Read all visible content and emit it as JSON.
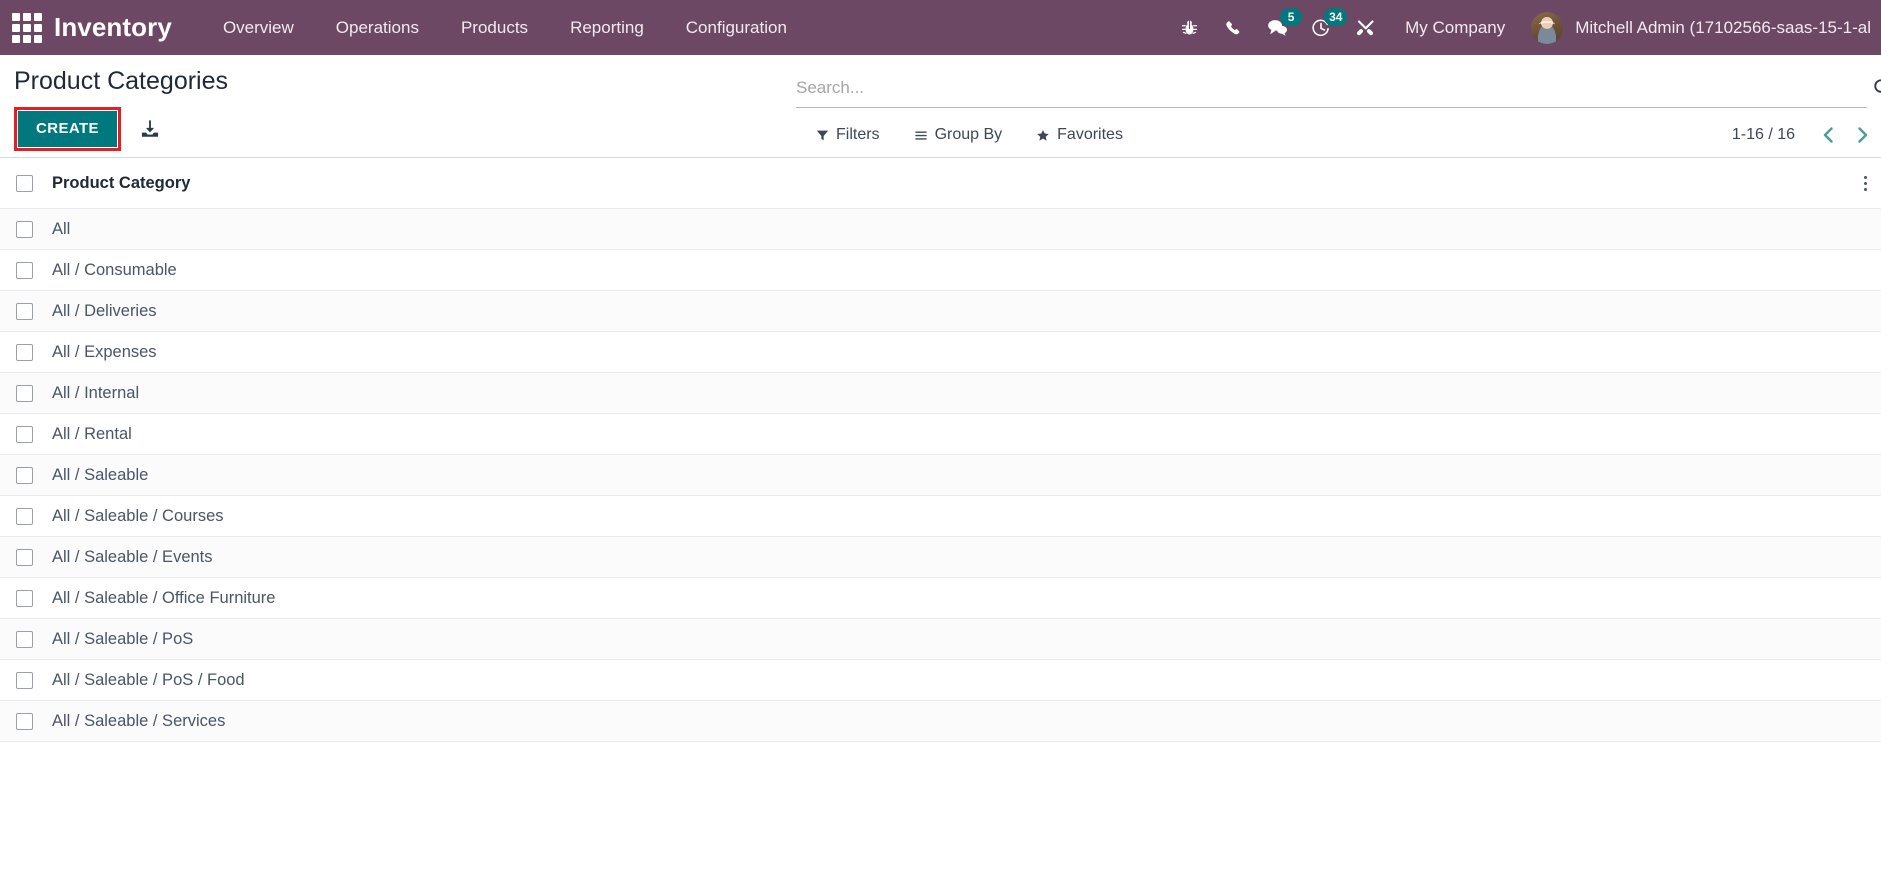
{
  "navbar": {
    "apps_icon": "apps-grid-icon",
    "brand": "Inventory",
    "menu": [
      {
        "label": "Overview"
      },
      {
        "label": "Operations"
      },
      {
        "label": "Products"
      },
      {
        "label": "Reporting"
      },
      {
        "label": "Configuration"
      }
    ],
    "sys_icons": [
      {
        "name": "bug-icon",
        "badge": null
      },
      {
        "name": "phone-icon",
        "badge": null
      },
      {
        "name": "messages-icon",
        "badge": "5"
      },
      {
        "name": "activities-clock-icon",
        "badge": "34"
      },
      {
        "name": "tools-icon",
        "badge": null
      }
    ],
    "company": "My Company",
    "user": "Mitchell Admin (17102566-saas-15-1-al",
    "avatar_icon": "user-avatar",
    "accent_color": "#6d4864",
    "badge_color": "#00787d"
  },
  "control_panel": {
    "title": "Product Categories",
    "create_label": "CREATE",
    "create_color": "#00787d",
    "highlight_color": "#e81c24",
    "export_icon": "download-export-icon",
    "search": {
      "placeholder": "Search...",
      "value": "",
      "icon": "search-magnifier-icon"
    },
    "actions": [
      {
        "label": "Filters",
        "icon": "filter-funnel-icon"
      },
      {
        "label": "Group By",
        "icon": "group-lines-icon"
      },
      {
        "label": "Favorites",
        "icon": "star-icon"
      }
    ],
    "pager": {
      "count": "1-16 / 16",
      "prev_icon": "chevron-left-icon",
      "next_icon": "chevron-right-icon",
      "arrow_color": "#4e9b9b"
    }
  },
  "table": {
    "select_all_icon": "select-all-checkbox",
    "options_icon": "column-options-dots-icon",
    "columns": [
      "Product Category"
    ],
    "rows": [
      {
        "name": "All"
      },
      {
        "name": "All / Consumable"
      },
      {
        "name": "All / Deliveries"
      },
      {
        "name": "All / Expenses"
      },
      {
        "name": "All / Internal"
      },
      {
        "name": "All / Rental"
      },
      {
        "name": "All / Saleable"
      },
      {
        "name": "All / Saleable / Courses"
      },
      {
        "name": "All / Saleable / Events"
      },
      {
        "name": "All / Saleable / Office Furniture"
      },
      {
        "name": "All / Saleable / PoS"
      },
      {
        "name": "All / Saleable / PoS / Food"
      },
      {
        "name": "All / Saleable / Services"
      }
    ]
  }
}
